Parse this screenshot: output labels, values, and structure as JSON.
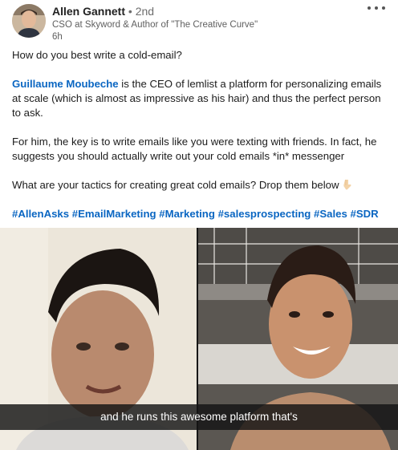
{
  "author": {
    "name": "Allen Gannett",
    "degree": "• 2nd",
    "headline": "CSO at Skyword & Author of \"The Creative Curve\"",
    "time": "6h"
  },
  "post": {
    "question": "How do you best write a cold-email?",
    "mention": "Guillaume Moubeche",
    "mention_rest": " is the CEO of lemlist a platform for personalizing emails at scale (which is almost as impressive as his hair) and thus the perfect person to ask.",
    "para2": "For him, the key is to write emails like you were texting with friends. In fact, he suggests you should actually write out your cold emails *in* messenger",
    "para3": "What are your tactics for creating great cold emails? Drop them below",
    "hashtags": [
      "#AllenAsks",
      "#EmailMarketing",
      "#Marketing",
      "#salesprospecting",
      "#Sales",
      "#SDR"
    ]
  },
  "video": {
    "caption": "and he runs this awesome platform that's"
  },
  "icons": {
    "more": "more-horizontal-icon",
    "pointing": "point-down-emoji-icon"
  },
  "colors": {
    "link": "#0a66c2",
    "caption_bg": "#141414"
  }
}
